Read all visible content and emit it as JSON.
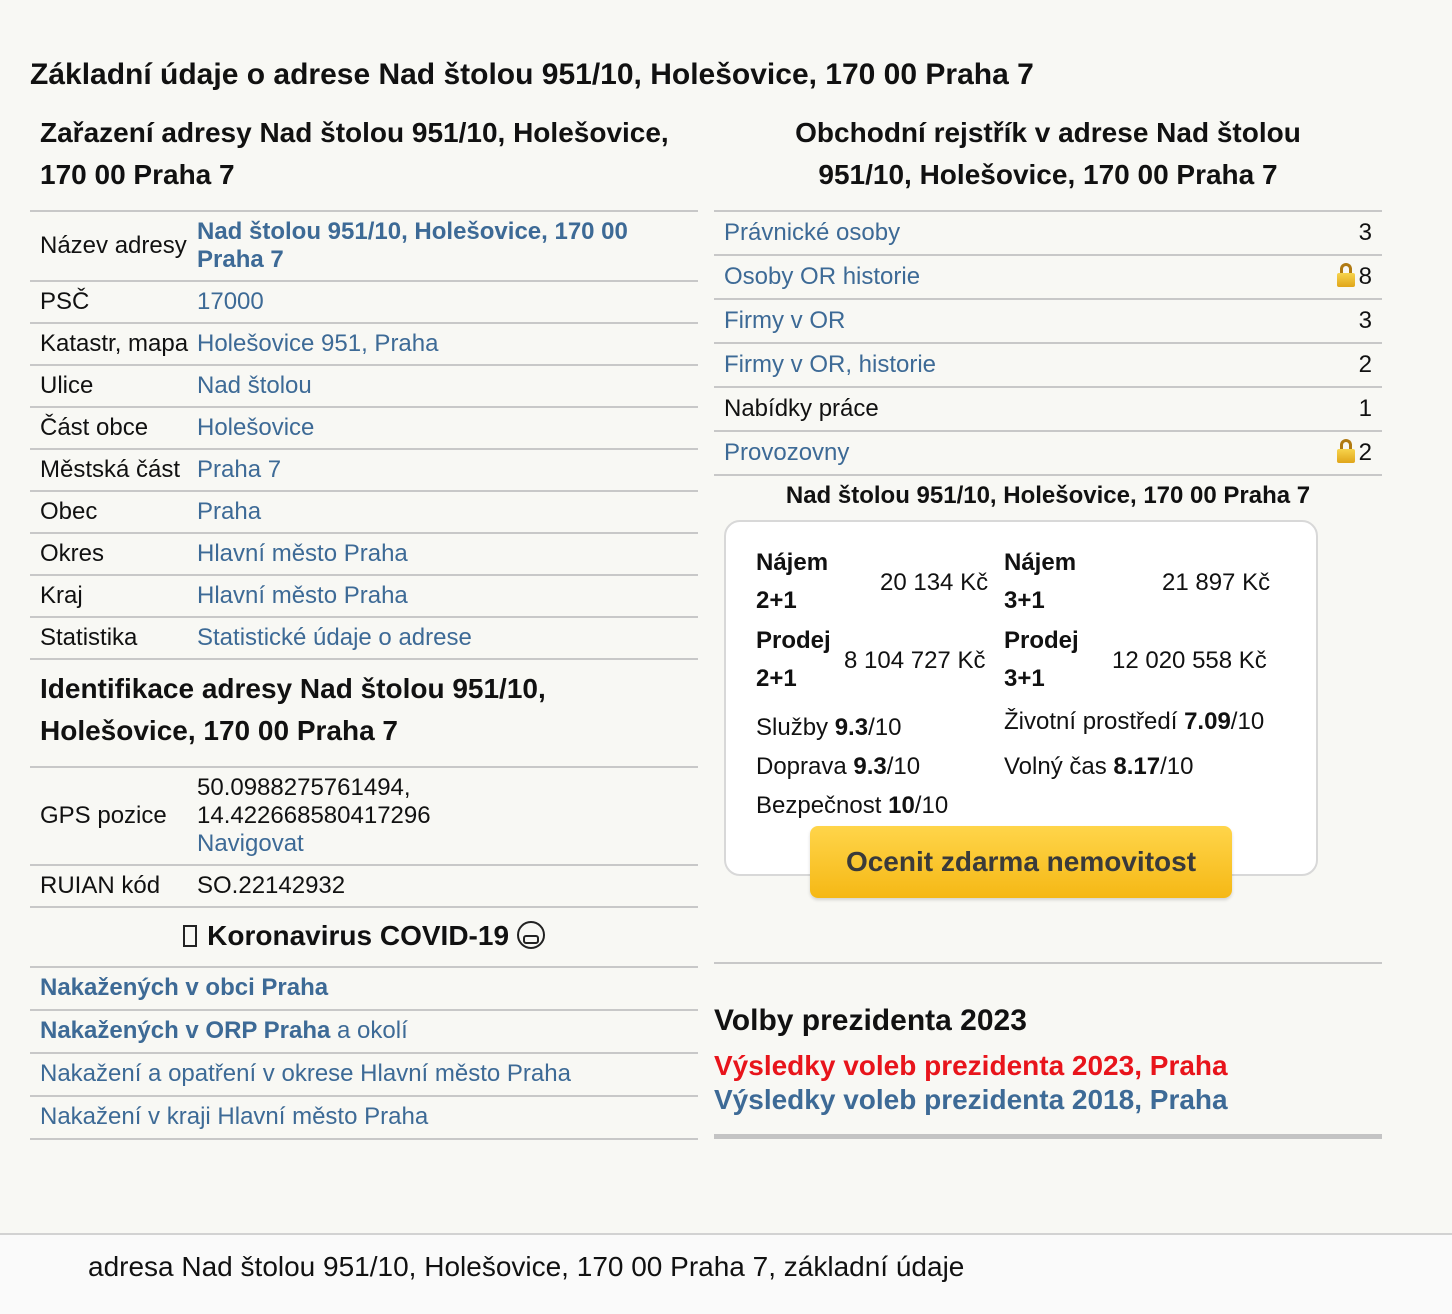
{
  "page_title": "Základní údaje o adrese Nad štolou 951/10, Holešovice, 170 00 Praha 7",
  "zarazeni": {
    "title": "Zařazení adresy Nad štolou 951/10, Holešovice, 170 00 Praha 7",
    "rows": [
      {
        "key": "Název adresy",
        "value": "Nad štolou 951/10, Holešovice, 170 00 Praha 7"
      },
      {
        "key": "PSČ",
        "value": "17000"
      },
      {
        "key": "Katastr, mapa",
        "value": "Holešovice 951, Praha"
      },
      {
        "key": "Ulice",
        "value": "Nad štolou"
      },
      {
        "key": "Část obce",
        "value": "Holešovice"
      },
      {
        "key": "Městská část",
        "value": "Praha 7"
      },
      {
        "key": "Obec",
        "value": "Praha"
      },
      {
        "key": "Okres",
        "value": "Hlavní město Praha"
      },
      {
        "key": "Kraj",
        "value": "Hlavní město Praha"
      },
      {
        "key": "Statistika",
        "value": "Statistické údaje o adrese"
      }
    ]
  },
  "identifikace": {
    "title": "Identifikace adresy Nad štolou 951/10, Holešovice, 170 00 Praha 7",
    "gps_label": "GPS pozice",
    "gps_lat": "50.0988275761494,",
    "gps_lon": "14.422668580417296",
    "navigate": "Navigovat",
    "ruian_label": "RUIAN kód",
    "ruian_value": "SO.22142932"
  },
  "covid": {
    "title": "Koronavirus COVID-19",
    "items": [
      {
        "link": "Nakažených v obci Praha",
        "suffix": ""
      },
      {
        "link": "Nakažených v ORP Praha",
        "suffix": " a okolí"
      },
      {
        "link": "Nakažení a opatření v okrese Hlavní město Praha",
        "suffix": ""
      },
      {
        "link": "Nakažení v kraji Hlavní město Praha",
        "suffix": ""
      }
    ]
  },
  "or": {
    "title": "Obchodní rejstřík v adrese Nad štolou 951/10, Holešovice, 170 00 Praha 7",
    "rows": [
      {
        "label": "Právnické osoby",
        "count": "3",
        "locked": false,
        "link": true
      },
      {
        "label": "Osoby OR historie",
        "count": "8",
        "locked": true,
        "link": true
      },
      {
        "label": "Firmy v OR",
        "count": "3",
        "locked": false,
        "link": true
      },
      {
        "label": "Firmy v OR, historie",
        "count": "2",
        "locked": false,
        "link": true
      },
      {
        "label": "Nabídky práce",
        "count": "1",
        "locked": false,
        "link": false
      },
      {
        "label": "Provozovny",
        "count": "2",
        "locked": true,
        "link": true
      }
    ]
  },
  "prices": {
    "address": "Nad štolou 951/10, Holešovice, 170 00 Praha 7",
    "najem21_l1": "Nájem",
    "najem21_l2": "2+1",
    "najem21_v": "20 134 Kč",
    "najem31_l1": "Nájem",
    "najem31_l2": "3+1",
    "najem31_v": "21 897 Kč",
    "prodej21_l1": "Prodej",
    "prodej21_l2": "2+1",
    "prodej21_v": "8 104 727 Kč",
    "prodej31_l1": "Prodej",
    "prodej31_l2": "3+1",
    "prodej31_v": "12 020 558 Kč",
    "sluzby_label": "Služby ",
    "sluzby_value": "9.3",
    "sluzby_max": "/10",
    "zivotni_label": "Životní prostředí ",
    "zivotni_value": "7.09",
    "zivotni_max": "/10",
    "doprava_label": "Doprava ",
    "doprava_value": "9.3",
    "doprava_max": "/10",
    "volny_label": "Volný čas ",
    "volny_value": "8.17",
    "volny_max": "/10",
    "bezpecnost_label": "Bezpečnost ",
    "bezpecnost_value": "10",
    "bezpecnost_max": "/10",
    "cta": "Ocenit zdarma nemovitost"
  },
  "volby": {
    "title": "Volby prezidenta 2023",
    "link2023": "Výsledky voleb prezidenta 2023, Praha",
    "link2018": "Výsledky voleb prezidenta 2018, Praha",
    "color2023": "#e8141b",
    "color2018": "#3d6a96"
  },
  "footer": "adresa Nad štolou 951/10, Holešovice, 170 00 Praha 7, základní údaje"
}
